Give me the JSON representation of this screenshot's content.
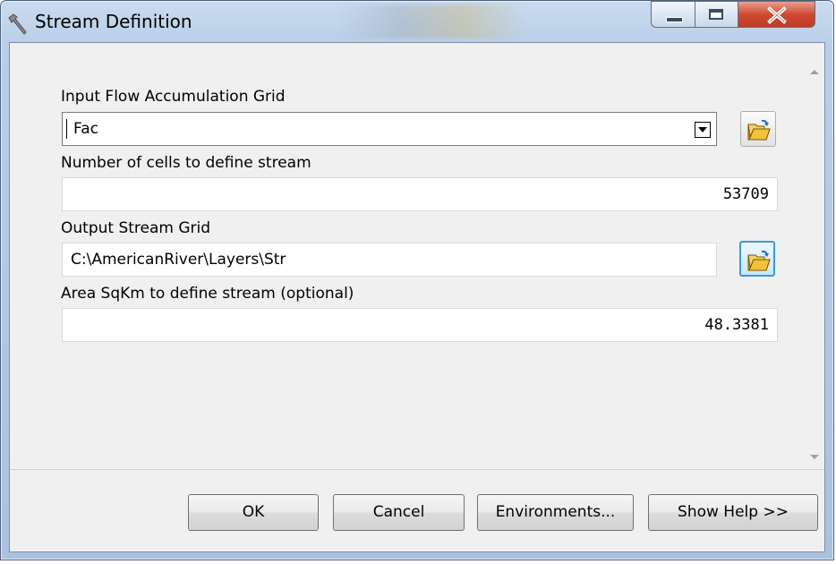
{
  "window": {
    "title": "Stream Definition",
    "icon": "hammer-icon"
  },
  "caption_buttons": {
    "minimize_icon": "minimize-icon",
    "maximize_icon": "maximize-icon",
    "close_icon": "close-icon"
  },
  "form": {
    "input_flow_label": "Input Flow Accumulation Grid",
    "input_flow_value": "Fac",
    "cells_label": "Number of cells to define stream",
    "cells_value": "53709",
    "output_label": "Output Stream Grid",
    "output_value": "C:\\AmericanRiver\\Layers\\Str",
    "area_label": "Area SqKm to define stream (optional)",
    "area_value": "48.3381"
  },
  "buttons": {
    "ok": "OK",
    "cancel": "Cancel",
    "environments": "Environments...",
    "show_help": "Show Help >>"
  },
  "colors": {
    "close_red": "#c23a24",
    "focus_blue": "#3c9ad8",
    "folder_yellow": "#f2c23a"
  }
}
